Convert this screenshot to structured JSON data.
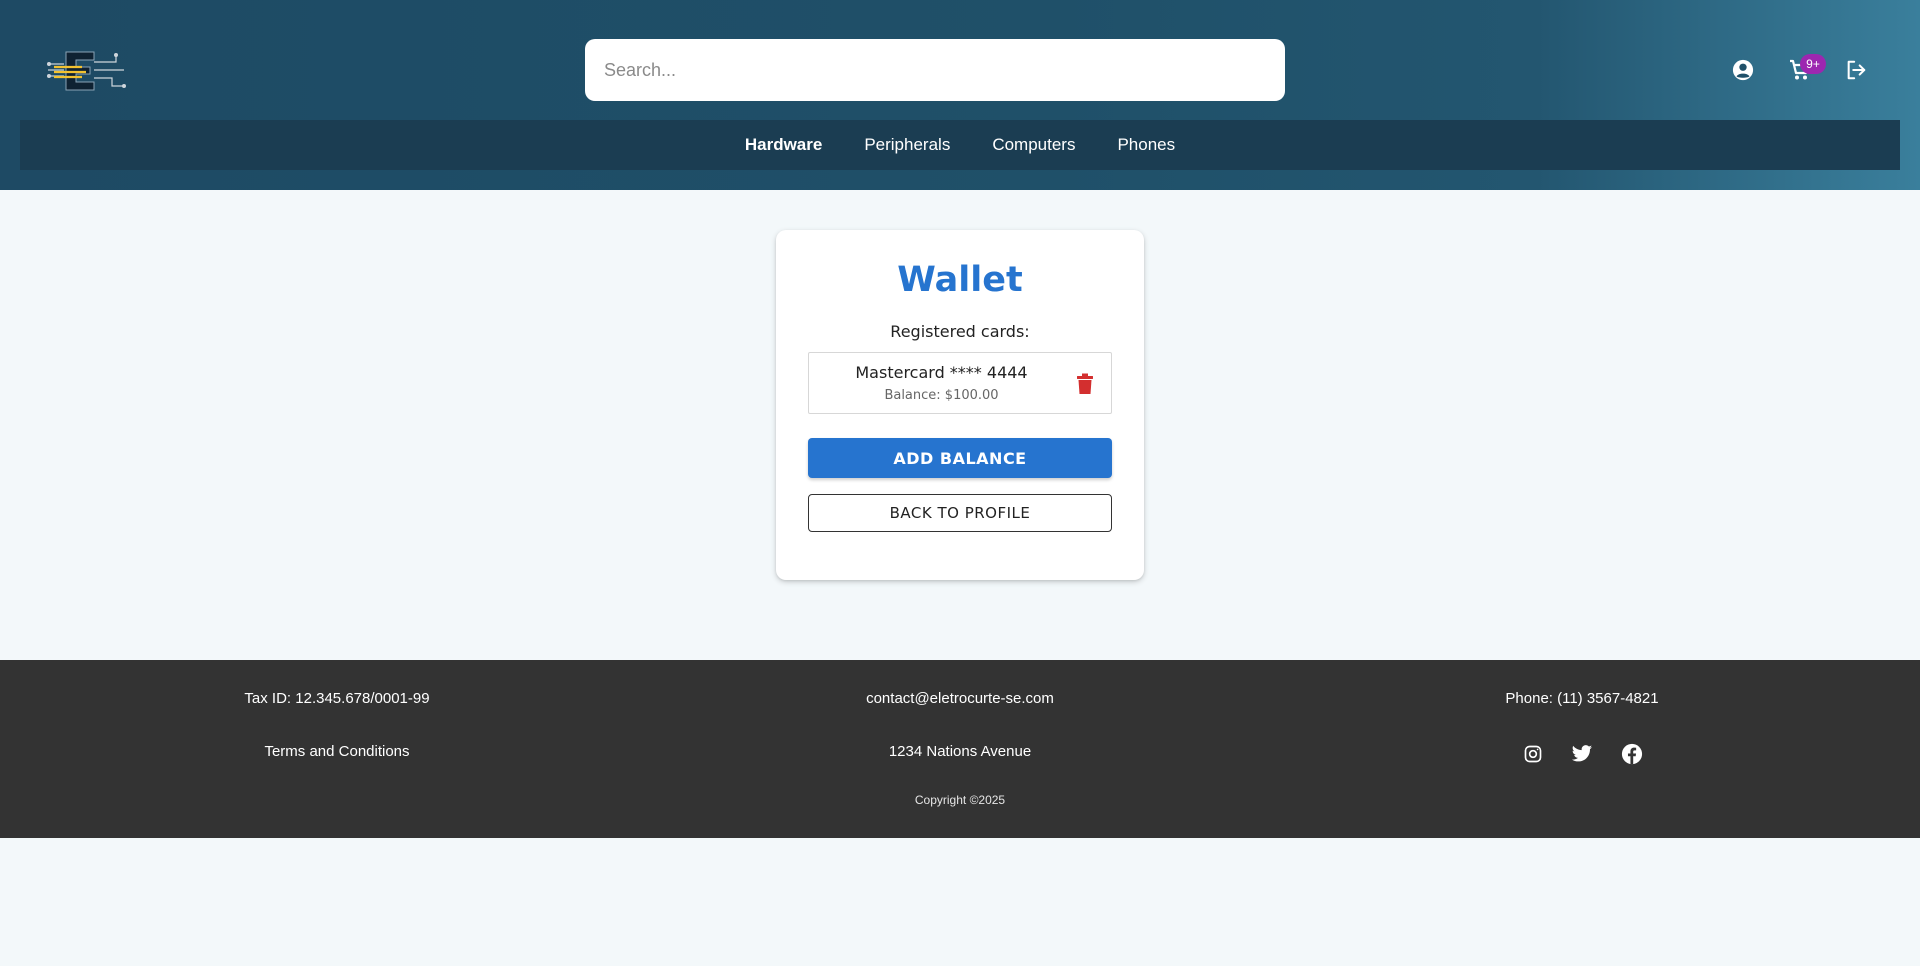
{
  "header": {
    "logo_name": "circuit-e-logo",
    "search_placeholder": "Search...",
    "cart_badge": "9+",
    "nav": [
      {
        "label": "Hardware",
        "active": true
      },
      {
        "label": "Peripherals",
        "active": false
      },
      {
        "label": "Computers",
        "active": false
      },
      {
        "label": "Phones",
        "active": false
      }
    ],
    "icons": [
      "account-circle-icon",
      "cart-icon",
      "logout-icon"
    ]
  },
  "wallet": {
    "title": "Wallet",
    "subtitle": "Registered cards:",
    "cards": [
      {
        "name": "Mastercard **** 4444",
        "balance": "Balance: $100.00"
      }
    ],
    "add_balance_label": "ADD BALANCE",
    "back_label": "BACK TO PROFILE"
  },
  "footer": {
    "tax_id": "Tax ID: 12.345.678/0001-99",
    "email": "contact@eletrocurte-se.com",
    "phone": "Phone: (11) 3567-4821",
    "terms": "Terms and Conditions",
    "address": "1234 Nations Avenue",
    "copyright": "Copyright ©2025",
    "social": [
      "instagram-icon",
      "twitter-icon",
      "facebook-icon"
    ]
  },
  "colors": {
    "header_bg": "#1f5069",
    "navbar_bg": "#1b3d52",
    "accent": "#2674cf",
    "danger": "#d32f2f",
    "badge": "#9c27b0",
    "footer_bg": "#333333",
    "page_bg": "#f3f8fa"
  }
}
